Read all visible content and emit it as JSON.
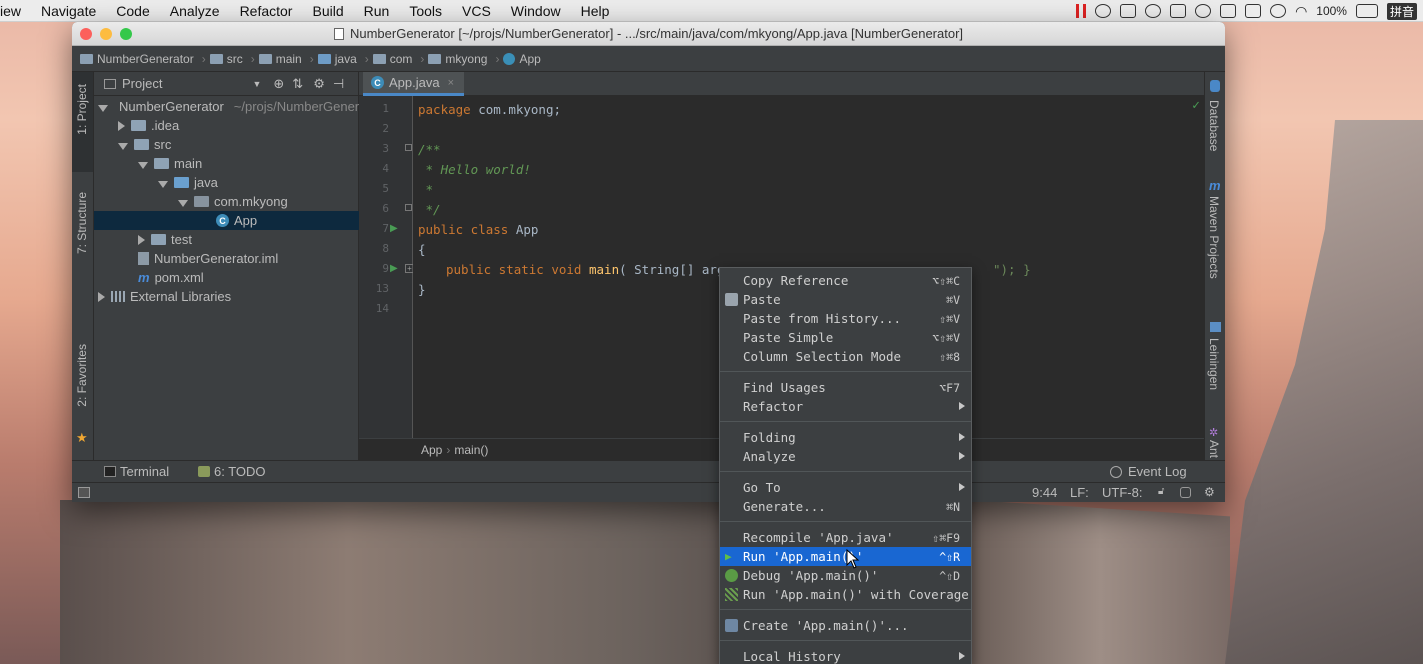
{
  "menubar": {
    "items": [
      "iew",
      "Navigate",
      "Code",
      "Analyze",
      "Refactor",
      "Build",
      "Run",
      "Tools",
      "VCS",
      "Window",
      "Help"
    ],
    "battery": "100%",
    "input_method": "拼音"
  },
  "window": {
    "title": "NumberGenerator [~/projs/NumberGenerator] - .../src/main/java/com/mkyong/App.java [NumberGenerator]"
  },
  "breadcrumbs": [
    "NumberGenerator",
    "src",
    "main",
    "java",
    "com",
    "mkyong",
    "App"
  ],
  "left_stripe": {
    "project": "1: Project",
    "structure": "7: Structure",
    "favorites": "2: Favorites"
  },
  "project_panel": {
    "header": "Project",
    "tree": [
      {
        "label": "NumberGenerator",
        "extra": "~/projs/NumberGenerator"
      },
      {
        "label": ".idea"
      },
      {
        "label": "src"
      },
      {
        "label": "main"
      },
      {
        "label": "java"
      },
      {
        "label": "com.mkyong"
      },
      {
        "label": "App"
      },
      {
        "label": "test"
      },
      {
        "label": "NumberGenerator.iml"
      },
      {
        "label": "pom.xml"
      },
      {
        "label": "External Libraries"
      }
    ]
  },
  "editor": {
    "tab": "App.java",
    "line_numbers": [
      "1",
      "2",
      "3",
      "4",
      "5",
      "6",
      "7",
      "8",
      "9",
      "13",
      "14"
    ],
    "code": {
      "l1_kw": "package",
      "l1_rest": " com.mkyong;",
      "l3": "/**",
      "l4": " * Hello world!",
      "l5": " *",
      "l6": " */",
      "l7_kw": "public class",
      "l7_rest": " App",
      "l8": "{",
      "l9_kw": "public static void",
      "l9_fn": "main",
      "l9_rest": "( String[] args ",
      "l9_tail": "\"); }",
      "l13": "}"
    },
    "breadcrumb": [
      "App",
      "main()"
    ]
  },
  "right_stripe": {
    "database": "Database",
    "maven": "Maven Projects",
    "leiningen": "Leiningen",
    "ant": "Ant"
  },
  "toolwindows": {
    "terminal": "Terminal",
    "todo": "6: TODO",
    "event_log": "Event Log"
  },
  "status": {
    "position": "9:44",
    "line_sep": "LF:",
    "encoding": "UTF-8:"
  },
  "context_menu": {
    "items": [
      {
        "label": "Copy Reference",
        "shortcut": "⌥⇧⌘C"
      },
      {
        "label": "Paste",
        "shortcut": "⌘V"
      },
      {
        "label": "Paste from History...",
        "shortcut": "⇧⌘V"
      },
      {
        "label": "Paste Simple",
        "shortcut": "⌥⇧⌘V"
      },
      {
        "label": "Column Selection Mode",
        "shortcut": "⇧⌘8"
      },
      {
        "label": "Find Usages",
        "shortcut": "⌥F7"
      },
      {
        "label": "Refactor",
        "shortcut": ""
      },
      {
        "label": "Folding",
        "shortcut": ""
      },
      {
        "label": "Analyze",
        "shortcut": ""
      },
      {
        "label": "Go To",
        "shortcut": ""
      },
      {
        "label": "Generate...",
        "shortcut": "⌘N"
      },
      {
        "label": "Recompile 'App.java'",
        "shortcut": "⇧⌘F9"
      },
      {
        "label": "Run 'App.main()'",
        "shortcut": "^⇧R"
      },
      {
        "label": "Debug 'App.main()'",
        "shortcut": "^⇧D"
      },
      {
        "label": "Run 'App.main()' with Coverage",
        "shortcut": ""
      },
      {
        "label": "Create 'App.main()'...",
        "shortcut": ""
      },
      {
        "label": "Local History",
        "shortcut": ""
      }
    ]
  },
  "colors": {
    "accent": "#1967d2",
    "run_green": "#499c54",
    "keyword": "#cc7832",
    "comment": "#629755"
  }
}
